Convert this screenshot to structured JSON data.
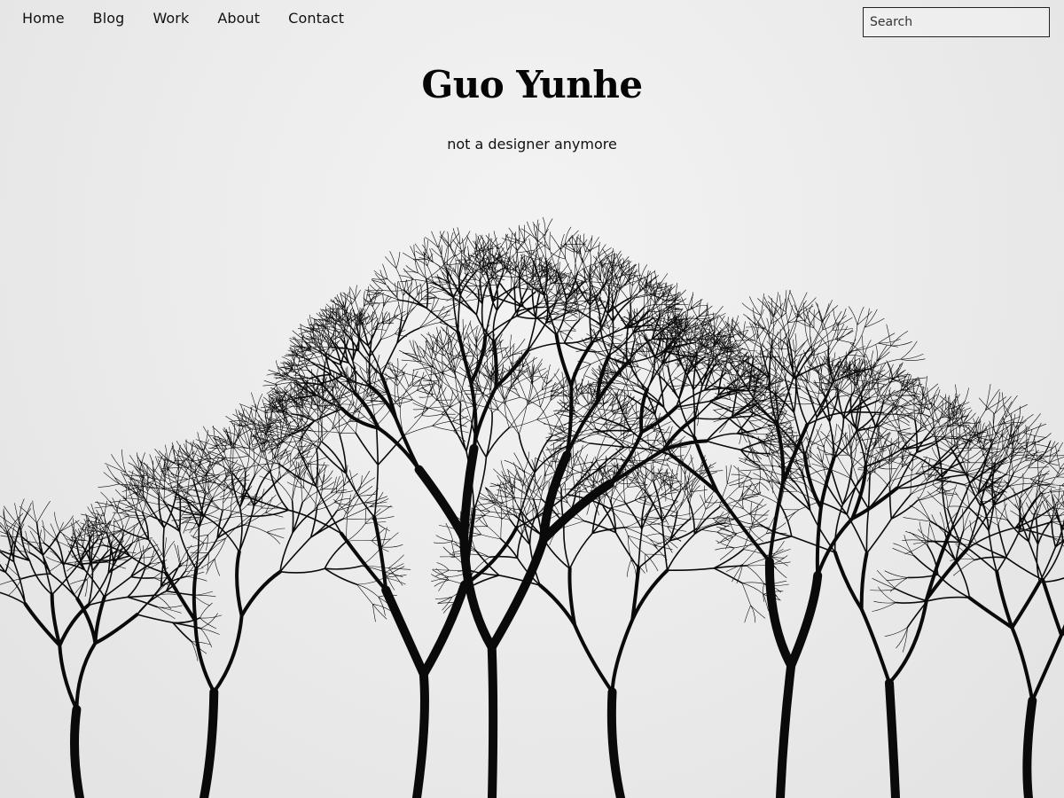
{
  "nav": {
    "items": [
      {
        "label": "Home"
      },
      {
        "label": "Blog"
      },
      {
        "label": "Work"
      },
      {
        "label": "About"
      },
      {
        "label": "Contact"
      }
    ]
  },
  "search": {
    "placeholder": "Search"
  },
  "header": {
    "title": "Guo Yunhe",
    "tagline": "not a designer anymore"
  },
  "background": {
    "subject": "bare-trees-photo",
    "colors": {
      "sky": "#ececec",
      "branches": "#0a0a0a"
    }
  }
}
